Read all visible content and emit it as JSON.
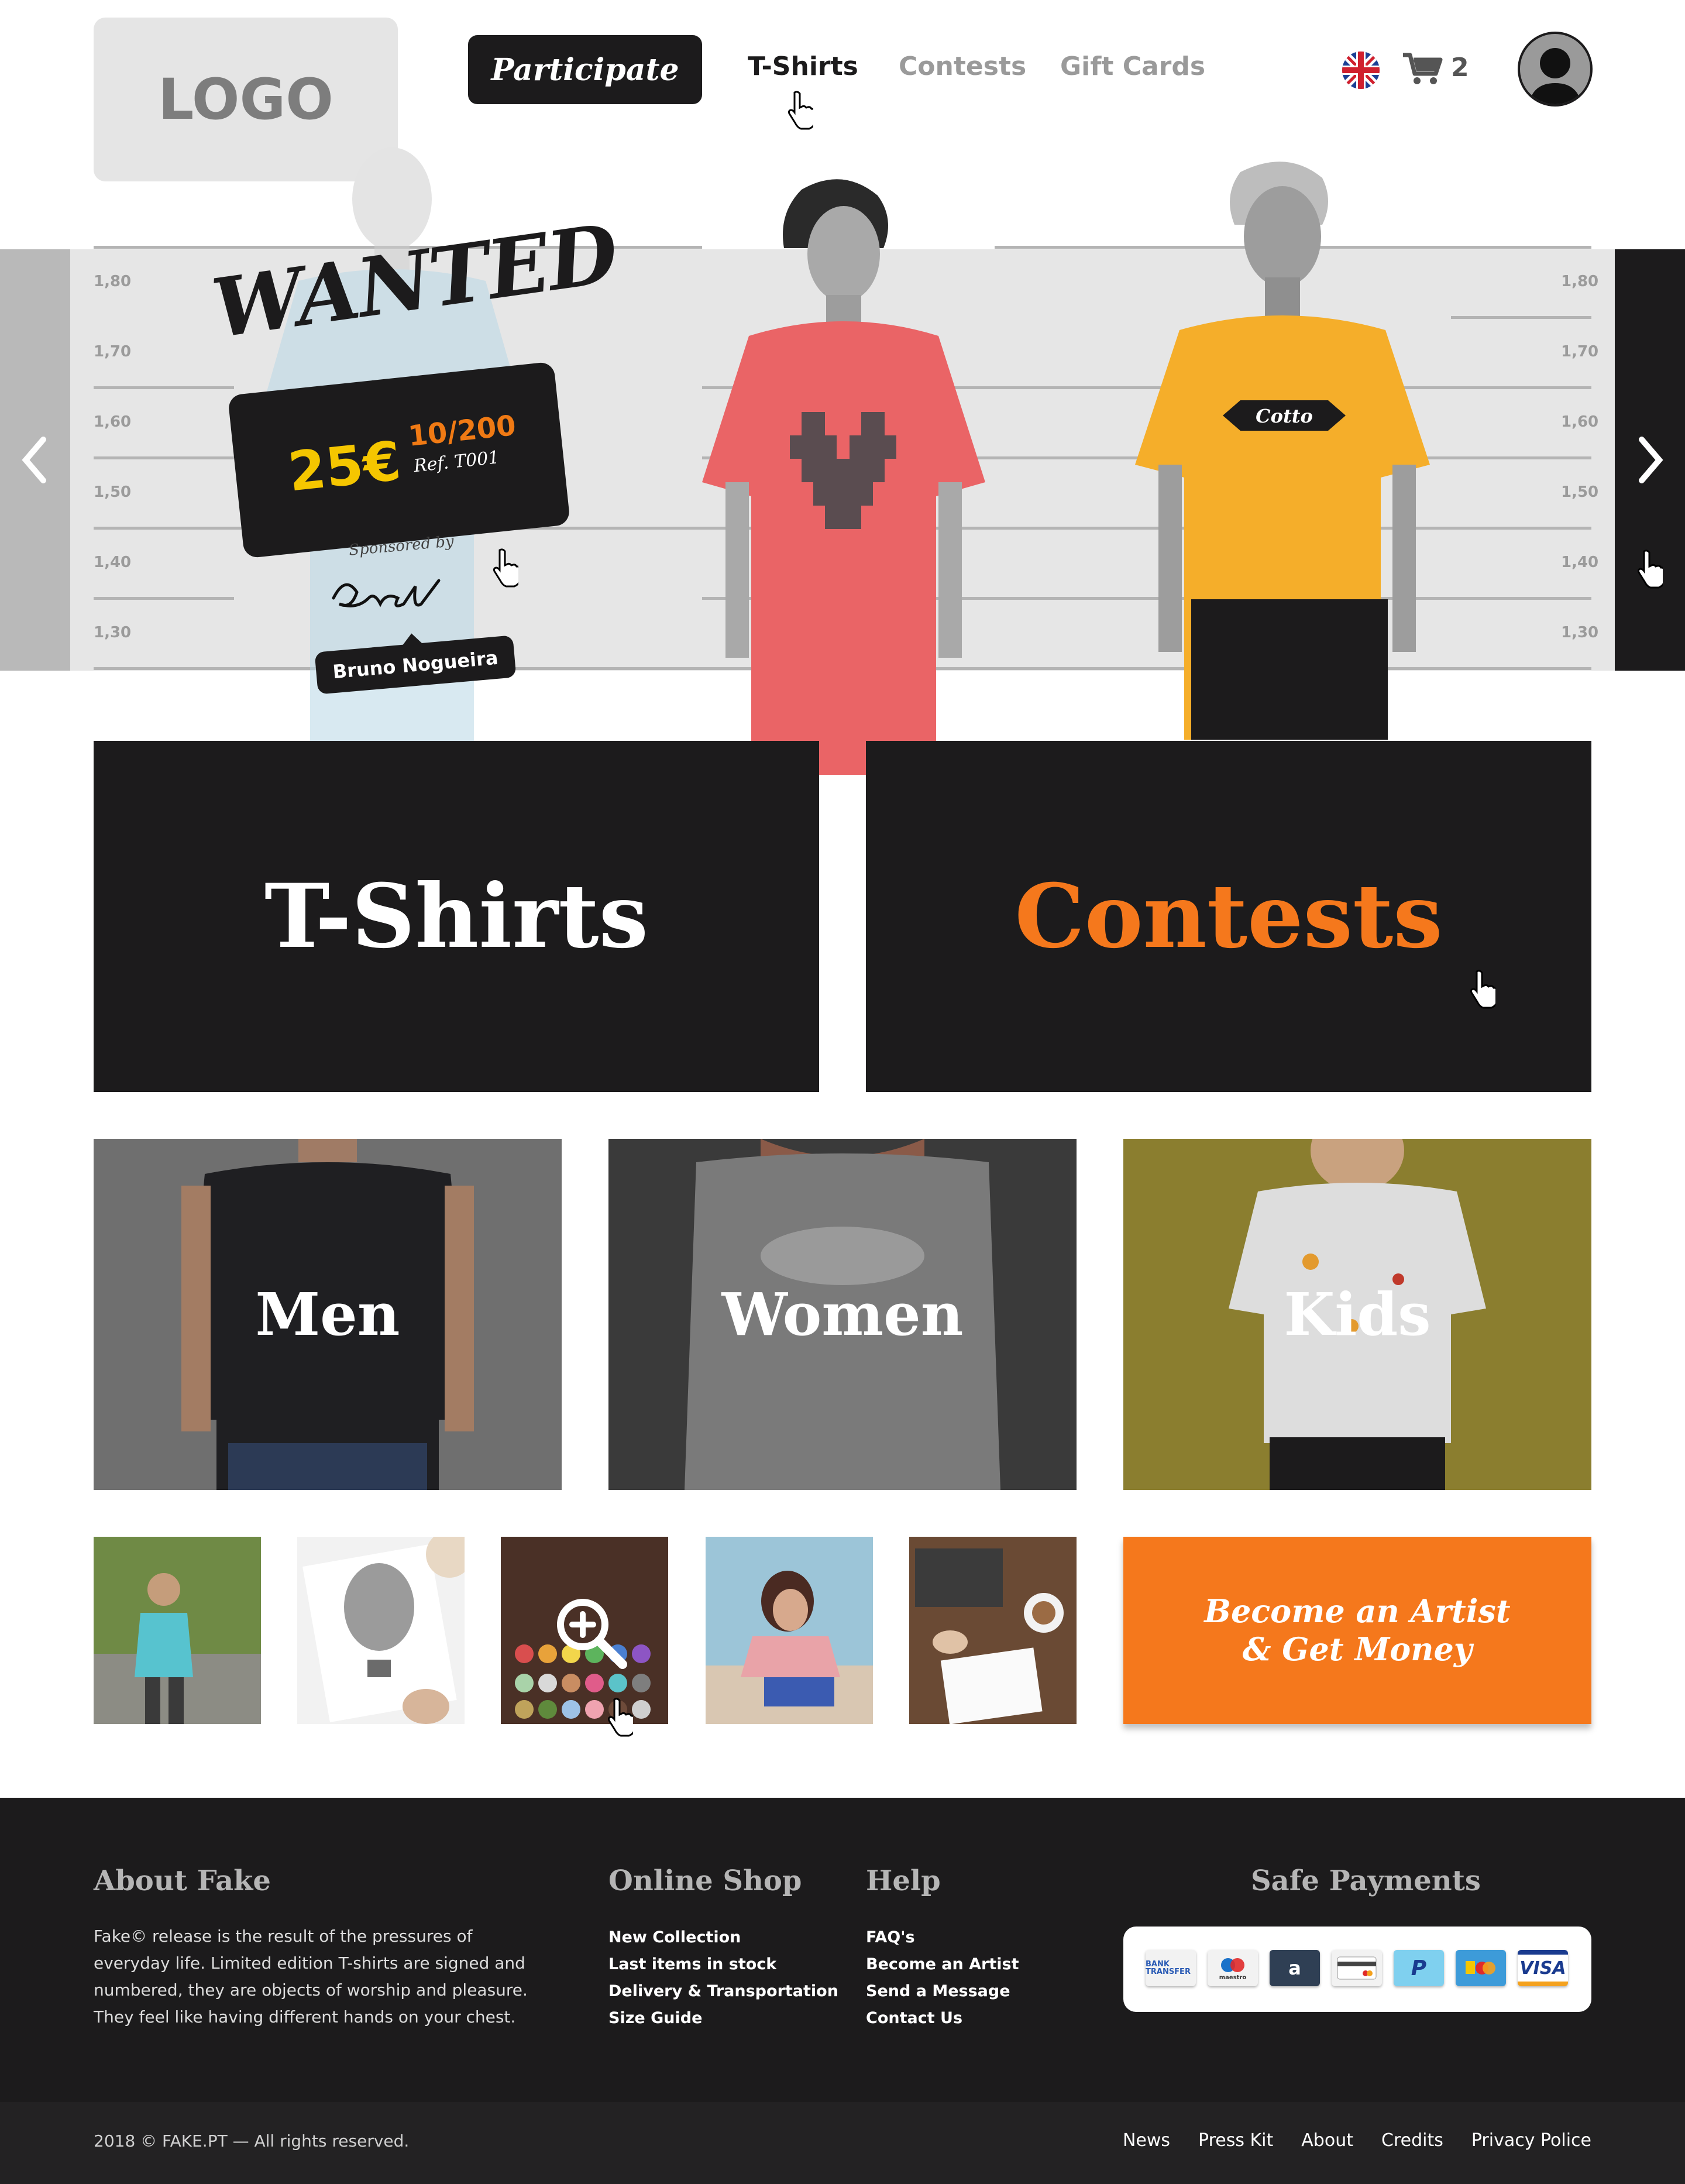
{
  "header": {
    "logo": "LOGO",
    "nav": {
      "participate": "Participate",
      "tshirts": "T-Shirts",
      "contests": "Contests",
      "gift_cards": "Gift Cards"
    },
    "cart_count": "2"
  },
  "hero": {
    "title": "WANTED",
    "price": "25€",
    "edition": "10/200",
    "ref": "Ref. T001",
    "sponsored_by": "Sponsored by",
    "sponsor_name": "Bruno Nogueira",
    "ruler_labels": [
      "1,80",
      "1,70",
      "1,60",
      "1,50",
      "1,40",
      "1,30"
    ],
    "shirt_print": "Cotto"
  },
  "sections": {
    "tshirts": "T-Shirts",
    "contests": "Contests"
  },
  "categories": {
    "men": "Men",
    "women": "Women",
    "kids": "Kids"
  },
  "artist_cta": {
    "line1": "Become an Artist",
    "line2": "& Get Money"
  },
  "footer": {
    "about": {
      "title": "About Fake",
      "text": "Fake© release is the result of the pressures of everyday life. Limited edition T-shirts are signed and numbered, they are objects of worship and pleasure. They feel like having different hands on your chest."
    },
    "shop": {
      "title": "Online Shop",
      "links": [
        "New Collection",
        "Last items in stock",
        "Delivery & Transportation",
        "Size Guide"
      ]
    },
    "help": {
      "title": "Help",
      "links": [
        "FAQ's",
        "Become an Artist",
        "Send a Message",
        "Contact Us"
      ]
    },
    "payments": {
      "title": "Safe Payments",
      "methods": [
        "BANK TRANSFER",
        "maestro",
        "a",
        "card",
        "P",
        "mastercard",
        "VISA"
      ]
    },
    "copyright": "2018 © FAKE.PT — All rights reserved.",
    "bottom_links": [
      "News",
      "Press Kit",
      "About",
      "Credits",
      "Privacy Police"
    ]
  },
  "colors": {
    "dark": "#1c1b1c",
    "accent_orange": "#f5781c",
    "price_yellow": "#f5c600"
  }
}
